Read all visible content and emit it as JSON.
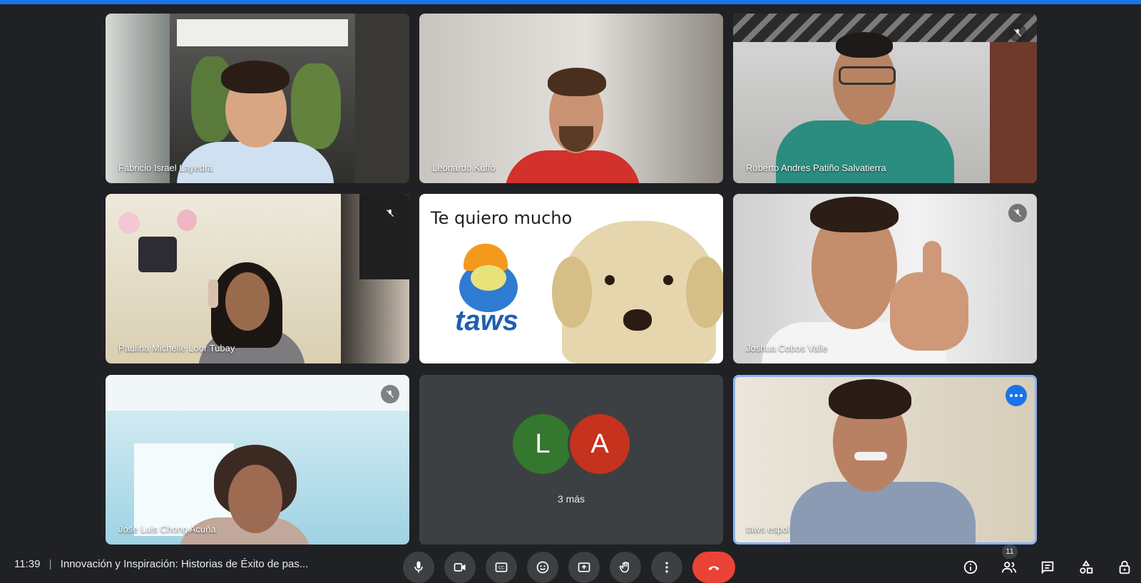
{
  "participants": [
    {
      "name": "Fabricio Israel Layedra",
      "muted": false
    },
    {
      "name": "Leonardo Kuffo",
      "muted": false
    },
    {
      "name": "Roberto Andres Patiño Salvatierra",
      "muted": true
    },
    {
      "name": "Paulina Michelle Loor Tubay",
      "muted": true
    },
    {
      "name": "Joshua Cobos Valle",
      "muted": true
    },
    {
      "name": "Jose Luis Chong Acuña",
      "muted": true
    },
    {
      "name": "taws espol",
      "muted": false
    }
  ],
  "shared_image": {
    "caption": "Te quiero mucho",
    "logo_text": "taws"
  },
  "others_tile": {
    "avatars": [
      {
        "letter": "L",
        "color": "#34772e"
      },
      {
        "letter": "A",
        "color": "#c5321d"
      }
    ],
    "more_label": "3 más"
  },
  "bottom_bar": {
    "time": "11:39",
    "separator": "|",
    "meeting_title": "Innovación y Inspiración: Historias de Éxito de pas...",
    "participant_count": "11",
    "controls": [
      "mic-icon",
      "camera-icon",
      "captions-icon",
      "emoji-icon",
      "present-icon",
      "raise-hand-icon",
      "more-options-icon",
      "end-call-icon"
    ],
    "right_controls": [
      "info-icon",
      "people-icon",
      "chat-icon",
      "activities-icon",
      "host-controls-icon"
    ]
  },
  "colors": {
    "background": "#202124",
    "accent": "#1a73e8",
    "end_call": "#ea4335"
  }
}
